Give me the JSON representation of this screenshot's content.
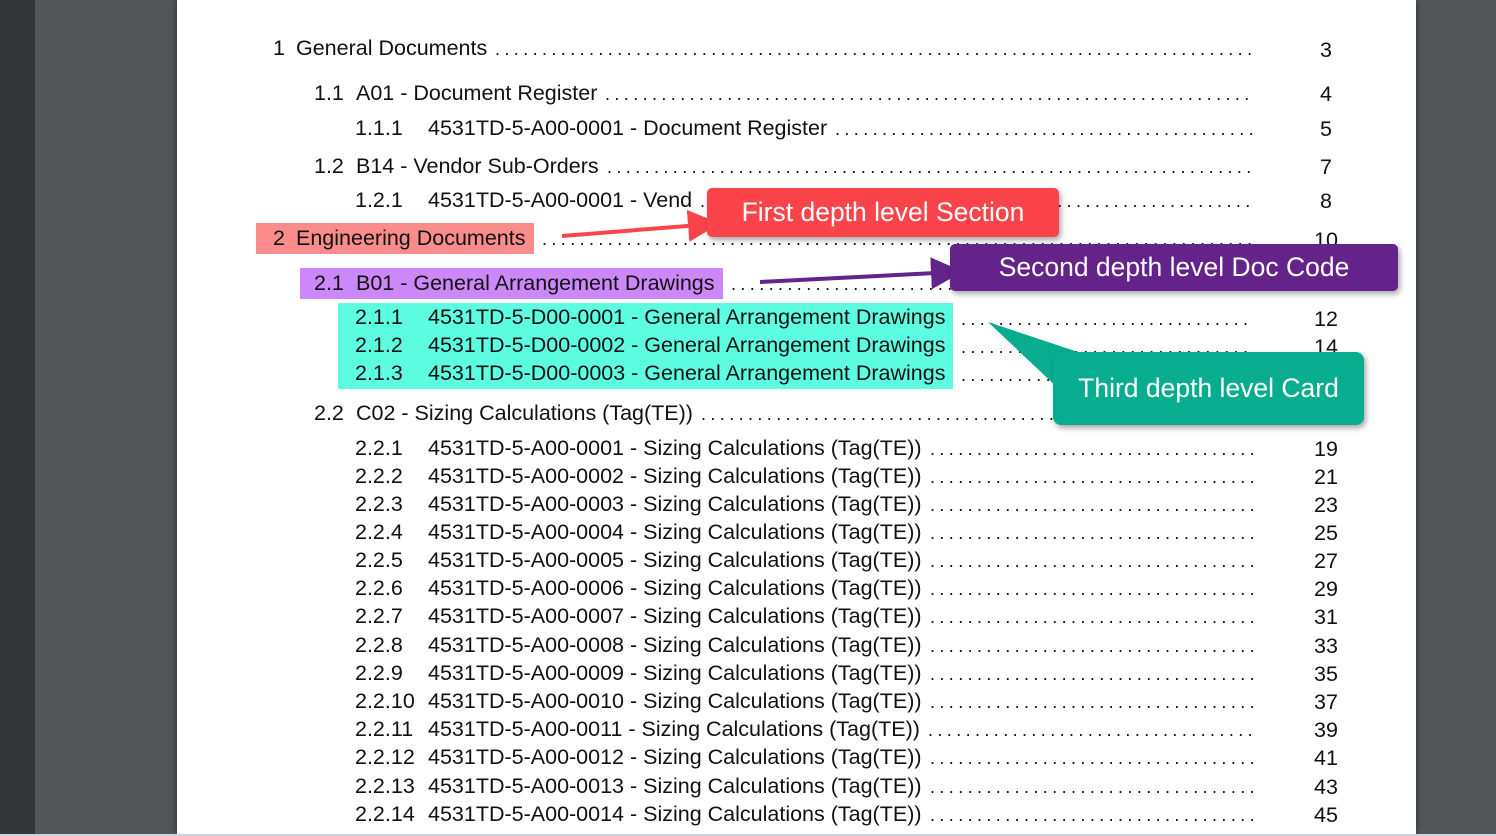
{
  "colors": {
    "section_highlight": "#fb8c8c",
    "doccode_highlight": "#cc88f8",
    "card_highlight": "#5cfde0",
    "callout_section": "#fb444a",
    "callout_doccode": "#63238a",
    "callout_card": "#08ad8f"
  },
  "toc": [
    {
      "num": "1",
      "title": "General Documents",
      "page": "3",
      "level": 1
    },
    {
      "num": "1.1",
      "title": "A01 - Document Register",
      "page": "4",
      "level": 2
    },
    {
      "num": "1.1.1",
      "title": "4531TD-5-A00-0001 - Document Register",
      "page": "5",
      "level": 3
    },
    {
      "num": "1.2",
      "title": "B14 - Vendor Sub-Orders",
      "page": "7",
      "level": 2
    },
    {
      "num": "1.2.1",
      "title": "4531TD-5-A00-0001 - Vend",
      "page": "8",
      "level": 3
    },
    {
      "num": "2",
      "title": "Engineering Documents",
      "page": "10",
      "level": 1,
      "highlight": "section"
    },
    {
      "num": "2.1",
      "title": "B01 - General Arrangement Drawings",
      "page": "",
      "level": 2,
      "highlight": "doccode"
    },
    {
      "num": "2.1.1",
      "title": "4531TD-5-D00-0001 - General Arrangement Drawings",
      "page": "12",
      "level": 3,
      "highlight": "card"
    },
    {
      "num": "2.1.2",
      "title": "4531TD-5-D00-0002 - General Arrangement Drawings",
      "page": "14",
      "level": 3,
      "highlight": "card"
    },
    {
      "num": "2.1.3",
      "title": "4531TD-5-D00-0003 - General Arrangement Drawings",
      "page": "",
      "level": 3,
      "highlight": "card"
    },
    {
      "num": "2.2",
      "title": "C02 - Sizing Calculations (Tag(TE))",
      "page": "",
      "level": 2
    },
    {
      "num": "2.2.1",
      "title": "4531TD-5-A00-0001 - Sizing Calculations (Tag(TE))",
      "page": "19",
      "level": 3
    },
    {
      "num": "2.2.2",
      "title": "4531TD-5-A00-0002 - Sizing Calculations (Tag(TE))",
      "page": "21",
      "level": 3
    },
    {
      "num": "2.2.3",
      "title": "4531TD-5-A00-0003 - Sizing Calculations (Tag(TE))",
      "page": "23",
      "level": 3
    },
    {
      "num": "2.2.4",
      "title": "4531TD-5-A00-0004 - Sizing Calculations (Tag(TE))",
      "page": "25",
      "level": 3
    },
    {
      "num": "2.2.5",
      "title": "4531TD-5-A00-0005 - Sizing Calculations (Tag(TE))",
      "page": "27",
      "level": 3
    },
    {
      "num": "2.2.6",
      "title": "4531TD-5-A00-0006 - Sizing Calculations (Tag(TE))",
      "page": "29",
      "level": 3
    },
    {
      "num": "2.2.7",
      "title": "4531TD-5-A00-0007 - Sizing Calculations (Tag(TE))",
      "page": "31",
      "level": 3
    },
    {
      "num": "2.2.8",
      "title": "4531TD-5-A00-0008 - Sizing Calculations (Tag(TE))",
      "page": "33",
      "level": 3
    },
    {
      "num": "2.2.9",
      "title": "4531TD-5-A00-0009 - Sizing Calculations (Tag(TE))",
      "page": "35",
      "level": 3
    },
    {
      "num": "2.2.10",
      "title": "4531TD-5-A00-0010 - Sizing Calculations (Tag(TE))",
      "page": "37",
      "level": 3
    },
    {
      "num": "2.2.11",
      "title": "4531TD-5-A00-0011 - Sizing Calculations (Tag(TE))",
      "page": "39",
      "level": 3
    },
    {
      "num": "2.2.12",
      "title": "4531TD-5-A00-0012 - Sizing Calculations (Tag(TE))",
      "page": "41",
      "level": 3
    },
    {
      "num": "2.2.13",
      "title": "4531TD-5-A00-0013 - Sizing Calculations (Tag(TE))",
      "page": "43",
      "level": 3
    },
    {
      "num": "2.2.14",
      "title": "4531TD-5-A00-0014 - Sizing Calculations (Tag(TE))",
      "page": "45",
      "level": 3
    }
  ],
  "callouts": {
    "section": "First depth level Section",
    "doccode": "Second depth level Doc Code",
    "card": "Third depth level Card"
  }
}
